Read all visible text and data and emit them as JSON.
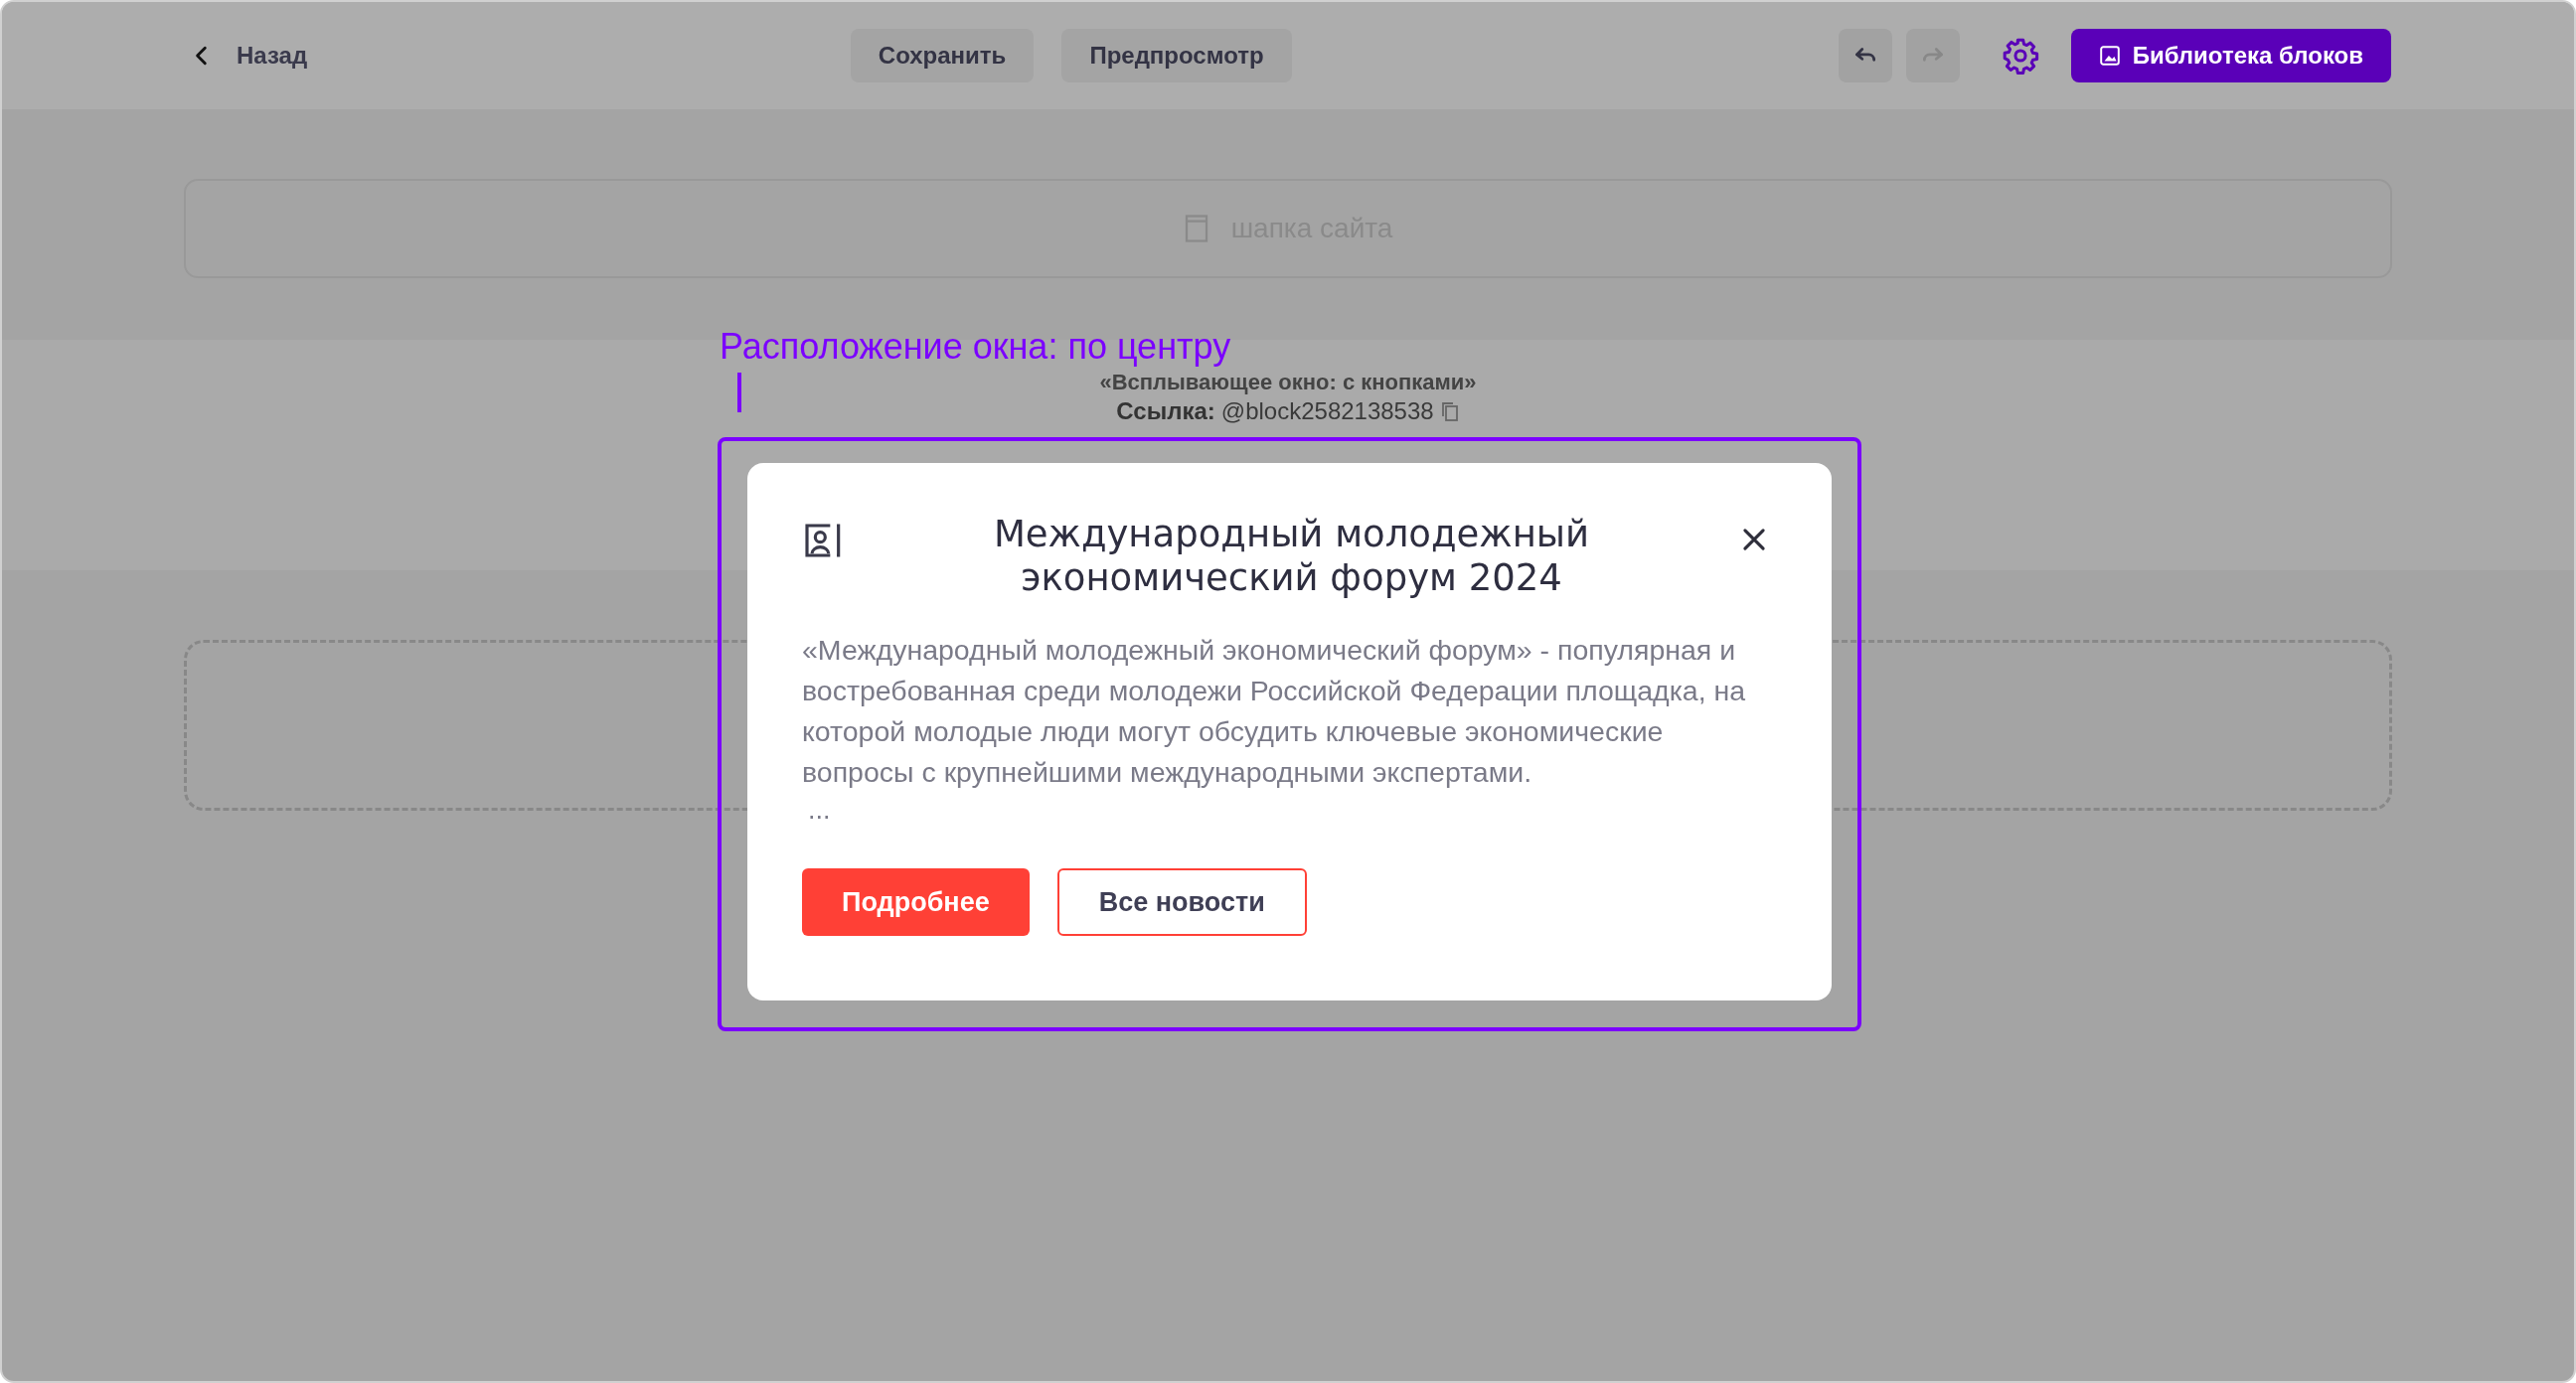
{
  "toolbar": {
    "back": "Назад",
    "buttons": [
      {
        "label": "Сохранить"
      },
      {
        "label": "Предпросмотр"
      }
    ],
    "undo": {
      "disabled": false
    },
    "redo": {
      "disabled": true
    },
    "library": "Библиотека блоков"
  },
  "header_placeholder": "шапка сайта",
  "position_label": "Расположение окна: по центру",
  "block": {
    "name": "«Всплывающее окно: с кнопками»",
    "link_label": "Ссылка:",
    "link": "@block2582138538"
  },
  "popup": {
    "title": "Международный молодежный экономический форум 2024",
    "text": "«Международный молодежный экономический форум» - популярная и востребованная среди молодежи Российской Федерации площадка, на которой молодые люди могут обсудить ключевые экономические вопросы с крупнейшими международными экспертами.",
    "ellipsis": "...",
    "buttons": [
      {
        "label": "Подробнее",
        "kind": "primary"
      },
      {
        "label": "Все новости",
        "kind": "outline"
      }
    ]
  }
}
